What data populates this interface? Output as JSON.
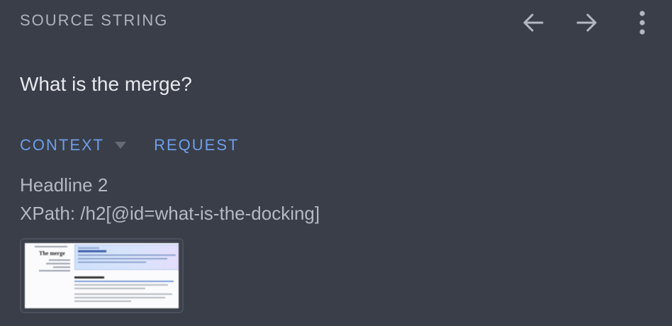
{
  "header": {
    "title": "SOURCE STRING"
  },
  "source": {
    "text": "What is the merge?"
  },
  "tabs": [
    {
      "label": "CONTEXT"
    },
    {
      "label": "REQUEST"
    }
  ],
  "context": {
    "line1": "Headline 2",
    "line2": "XPath: /h2[@id=what-is-the-docking]"
  },
  "screenshot": {
    "title": "The merge"
  },
  "icons": {
    "prev": "arrow-left-icon",
    "next": "arrow-right-icon",
    "more": "more-vertical-icon",
    "caret": "caret-down-icon"
  },
  "colors": {
    "background": "#393e49",
    "accent": "#6f9ee8",
    "text": "#e6e8ec",
    "muted": "#aeb3bc"
  }
}
